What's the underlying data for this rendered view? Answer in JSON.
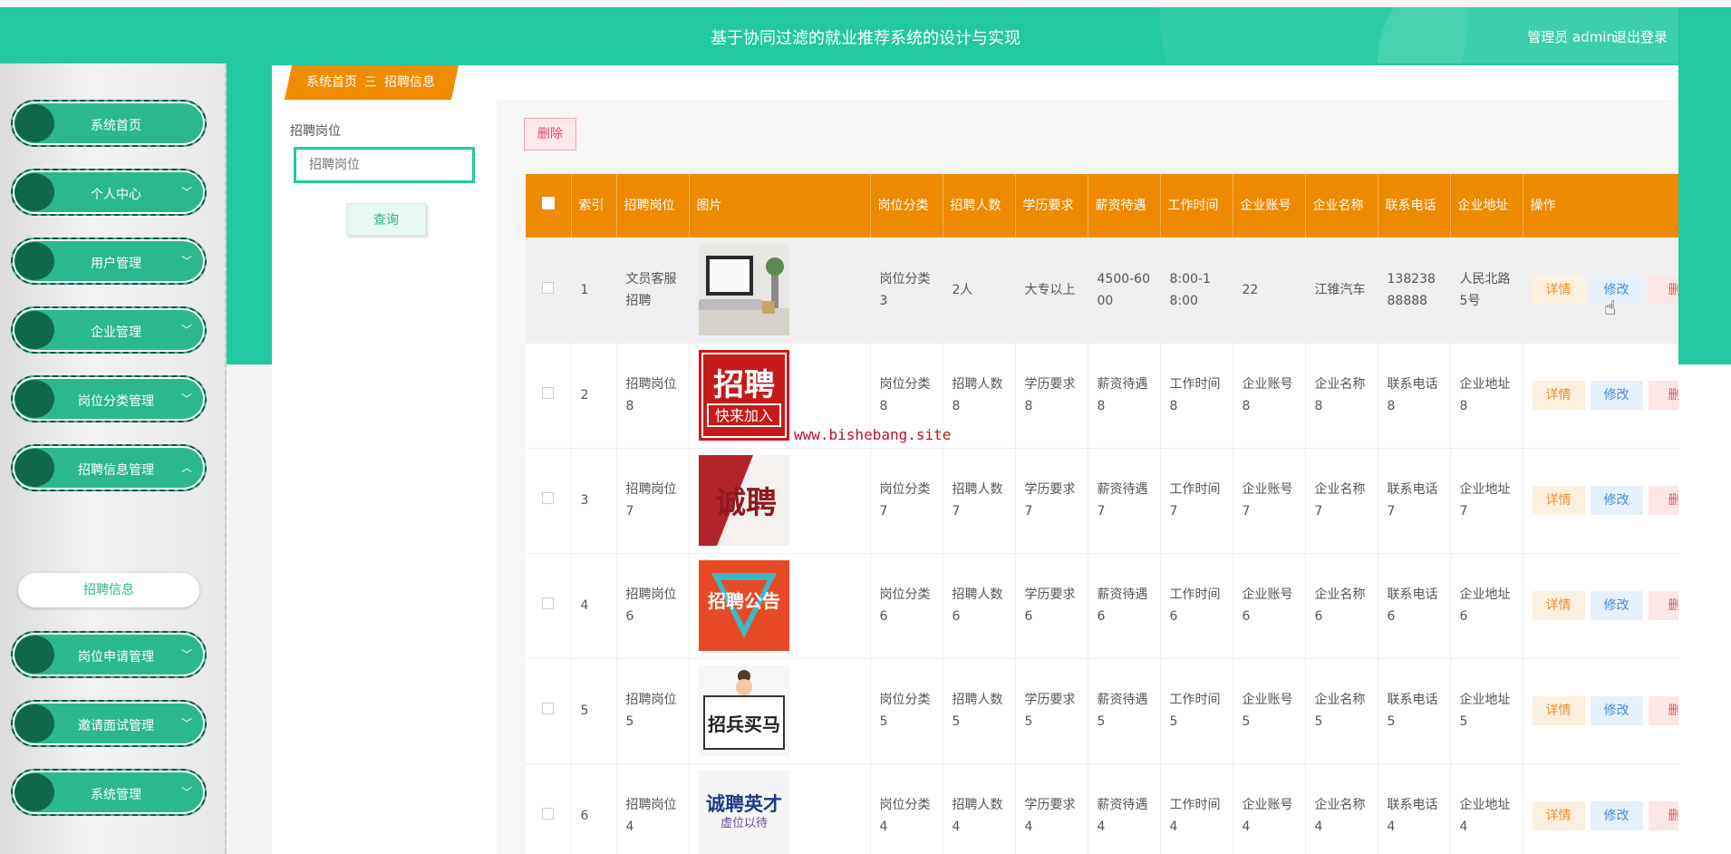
{
  "header": {
    "title": "基于协同过滤的就业推荐系统的设计与实现",
    "admin_label": "管理员 admin",
    "logout_label": "退出登录"
  },
  "sidebar": {
    "items": [
      {
        "label": "系统首页",
        "chevron": ""
      },
      {
        "label": "个人中心",
        "chevron": "﹀"
      },
      {
        "label": "用户管理",
        "chevron": "﹀"
      },
      {
        "label": "企业管理",
        "chevron": "﹀"
      },
      {
        "label": "岗位分类管理",
        "chevron": "﹀"
      },
      {
        "label": "招聘信息管理",
        "chevron": "︿"
      },
      {
        "label": "岗位申请管理",
        "chevron": "﹀"
      },
      {
        "label": "邀请面试管理",
        "chevron": "﹀"
      },
      {
        "label": "系统管理",
        "chevron": "﹀"
      }
    ],
    "submenu": {
      "label": "招聘信息"
    }
  },
  "breadcrumb": {
    "home": "系统首页",
    "separator": "三",
    "current": "招聘信息"
  },
  "search": {
    "label": "招聘岗位",
    "placeholder": "招聘岗位",
    "button": "查询"
  },
  "toolbar": {
    "delete_label": "删除"
  },
  "table": {
    "headers": [
      "索引",
      "招聘岗位",
      "图片",
      "岗位分类",
      "招聘人数",
      "学历要求",
      "薪资待遇",
      "工作时间",
      "企业账号",
      "企业名称",
      "联系电话",
      "企业地址",
      "操作"
    ],
    "actions": {
      "detail": "详情",
      "edit": "修改",
      "delete": "删"
    },
    "rows": [
      {
        "index": "1",
        "position": "文员客服招聘",
        "image": "laptop-photo",
        "category": "岗位分类3",
        "count": "2人",
        "education": "大专以上",
        "salary": "4500-6000",
        "hours": "8:00-18:00",
        "account": "22",
        "company": "江锥汽车",
        "phone": "13823888888",
        "address": "人民北路5号"
      },
      {
        "index": "2",
        "position": "招聘岗位8",
        "image": "zhaopin-kuailaijiaru",
        "category": "岗位分类8",
        "count": "招聘人数8",
        "education": "学历要求8",
        "salary": "薪资待遇8",
        "hours": "工作时间8",
        "account": "企业账号8",
        "company": "企业名称8",
        "phone": "联系电话8",
        "address": "企业地址8"
      },
      {
        "index": "3",
        "position": "招聘岗位7",
        "image": "chengpin",
        "category": "岗位分类7",
        "count": "招聘人数7",
        "education": "学历要求7",
        "salary": "薪资待遇7",
        "hours": "工作时间7",
        "account": "企业账号7",
        "company": "企业名称7",
        "phone": "联系电话7",
        "address": "企业地址7"
      },
      {
        "index": "4",
        "position": "招聘岗位6",
        "image": "zhaopin-gonggao",
        "category": "岗位分类6",
        "count": "招聘人数6",
        "education": "学历要求6",
        "salary": "薪资待遇6",
        "hours": "工作时间6",
        "account": "企业账号6",
        "company": "企业名称6",
        "phone": "联系电话6",
        "address": "企业地址6"
      },
      {
        "index": "5",
        "position": "招聘岗位5",
        "image": "zhaobing-maima",
        "category": "岗位分类5",
        "count": "招聘人数5",
        "education": "学历要求5",
        "salary": "薪资待遇5",
        "hours": "工作时间5",
        "account": "企业账号5",
        "company": "企业名称5",
        "phone": "联系电话5",
        "address": "企业地址5"
      },
      {
        "index": "6",
        "position": "招聘岗位4",
        "image": "chengpin-yingcai",
        "category": "岗位分类4",
        "count": "招聘人数4",
        "education": "学历要求4",
        "salary": "薪资待遇4",
        "hours": "工作时间4",
        "account": "企业账号4",
        "company": "企业名称4",
        "phone": "联系电话4",
        "address": "企业地址4"
      }
    ]
  },
  "images": {
    "zhaopin_big": "招聘",
    "kuailai": "快来加入",
    "chengpin": "诚聘",
    "gonggao": "招聘公告",
    "zhaobing": "招兵买马",
    "yingcai": "诚聘英才",
    "qidai": "虚位以待"
  },
  "watermark": "www.bishebang.site",
  "colors": {
    "primary": "#22c9a0",
    "header_orange": "#ee8a00",
    "menu_green": "#2bb88f"
  }
}
